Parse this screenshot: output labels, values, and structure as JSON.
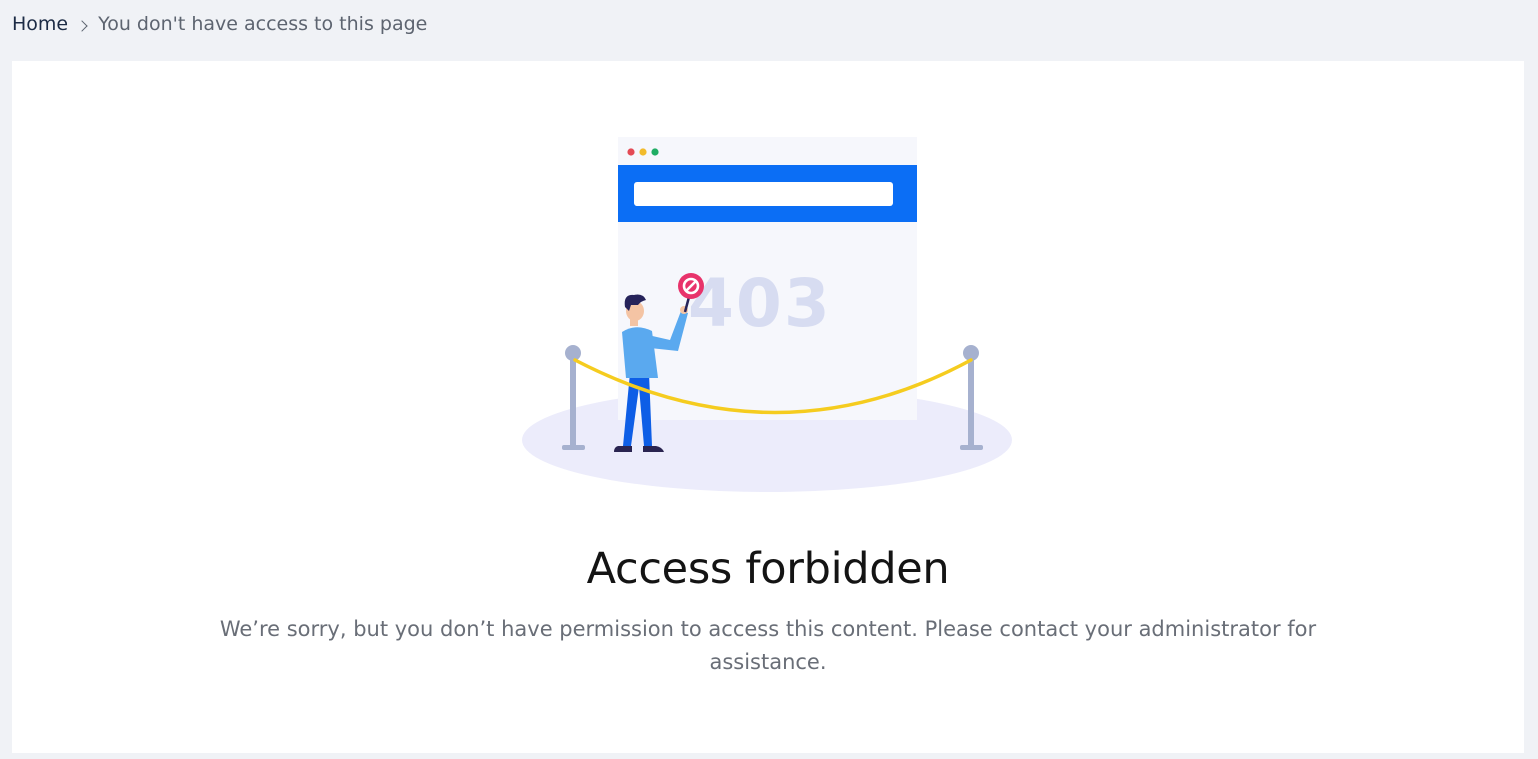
{
  "breadcrumb": {
    "home_label": "Home",
    "current_label": "You don't have access to this page"
  },
  "illustration": {
    "error_code": "403",
    "icons": [
      "browser-window-icon",
      "no-entry-sign-icon",
      "person-figure",
      "rope-barrier"
    ]
  },
  "content": {
    "title": "Access forbidden",
    "message": "We’re sorry, but you don’t have permission to access this content. Please contact your administrator for assistance."
  },
  "colors": {
    "page_background": "#f0f2f6",
    "card_background": "#ffffff",
    "browser_accent": "#0b6ef5",
    "rope": "#f5cc1f",
    "no_entry_sign": "#e8336b",
    "stanchion": "#a6b1cf"
  }
}
